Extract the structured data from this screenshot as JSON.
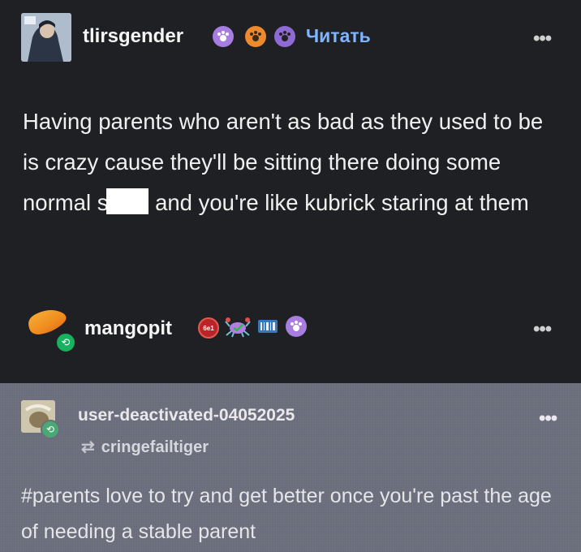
{
  "post1": {
    "username": "tlirsgender",
    "follow_label": "Читать",
    "more_label": "•••",
    "text_before": "Having parents who aren't as bad as they used to be is crazy cause they'll be sitting there doing some normal s",
    "text_after": " and you're like kubrick staring at them",
    "badges": [
      "paw-badge-purple",
      "paw-badge-orange",
      "paw-badge-purple-dark"
    ]
  },
  "post2": {
    "username": "mangopit",
    "more_label": "•••",
    "badges": [
      "counter-badge",
      "crab-badge",
      "barcode-badge",
      "paw-badge-purple"
    ],
    "counter_text": "6e1"
  },
  "post3": {
    "username": "user-deactivated-04052025",
    "via": "cringefailtiger",
    "more_label": "•••",
    "text": "#parents love to try and get better once you're past the age of needing a stable parent"
  },
  "colors": {
    "link": "#7fb4ff",
    "reblog_green": "#16b25f",
    "dark_bg": "#1f2023",
    "quote_bg": "#6a6d7b"
  }
}
